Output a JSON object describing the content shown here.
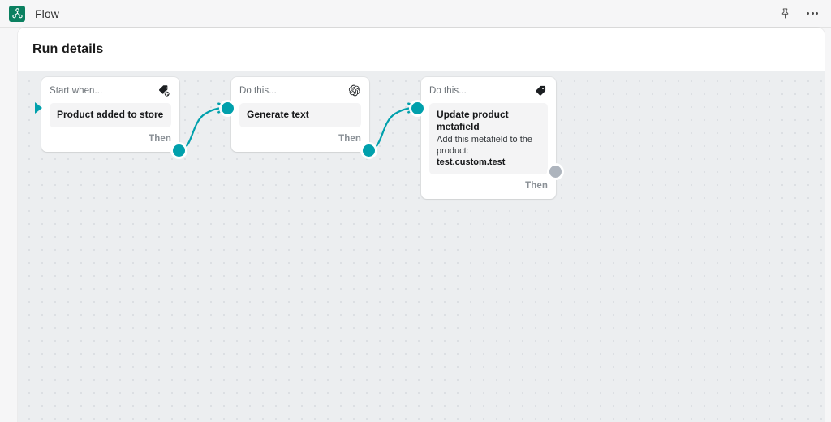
{
  "topbar": {
    "app_name": "Flow",
    "logo_icon": "flow-graph-logo",
    "logo_color": "#0b8060",
    "pin_icon": "pin-icon",
    "more_icon": "more-horizontal-icon"
  },
  "page": {
    "title": "Run details"
  },
  "canvas": {
    "accent_color": "#00a0ac",
    "inactive_color": "#adb4bd",
    "background_color": "#eceef0",
    "dot_color": "#dcdfe3"
  },
  "nodes": [
    {
      "id": "trigger",
      "kind_label": "Start when...",
      "icon": "tag-plus-icon",
      "title": "Product added to store",
      "subtitle": "",
      "value": "",
      "footer_label": "Then",
      "footer_state": "active"
    },
    {
      "id": "action-generate-text",
      "kind_label": "Do this...",
      "icon": "openai-icon",
      "title": "Generate text",
      "subtitle": "",
      "value": "",
      "footer_label": "Then",
      "footer_state": "active"
    },
    {
      "id": "action-update-metafield",
      "kind_label": "Do this...",
      "icon": "tag-icon",
      "title": "Update product metafield",
      "subtitle": "Add this metafield to the product:",
      "value": "test.custom.test",
      "footer_label": "Then",
      "footer_state": "inactive"
    }
  ]
}
